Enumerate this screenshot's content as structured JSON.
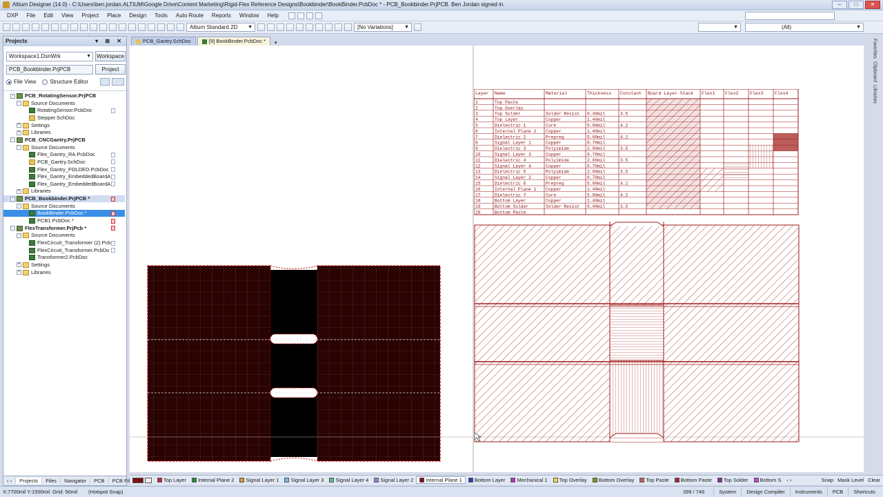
{
  "titlebar": {
    "title": "Altium Designer (14.0) - C:\\Users\\ben.jordan.ALTIUM\\Google Drive\\Content Marketing\\Rigid-Flex Reference Designs\\Bookbinder\\BookBinder.PcbDoc * - PCB_Bookbinder.PrjPCB. Ben Jordan signed in."
  },
  "menu": [
    "DXP",
    "File",
    "Edit",
    "View",
    "Project",
    "Place",
    "Design",
    "Tools",
    "Auto Route",
    "Reports",
    "Window",
    "Help"
  ],
  "toolbar": {
    "view_config": "Altium Standard 2D",
    "variations": "[No Variations]",
    "filter": "(All)"
  },
  "projects_panel": {
    "title": "Projects",
    "workspace_value": "Workspace1.DsnWrk",
    "workspace_button": "Workspace",
    "project_value": "PCB_Bookbinder.PrjPCB",
    "project_button": "Project",
    "radio_file_view": "File View",
    "radio_structure_editor": "Structure Editor",
    "tree": [
      {
        "label": "PCB_RotatingSensor.PrjPCB",
        "level": 0,
        "icon": "proj",
        "exp": "-",
        "bold": true
      },
      {
        "label": "Source Documents",
        "level": 1,
        "icon": "folder",
        "exp": "-"
      },
      {
        "label": "RotatingSensor.PcbDoc",
        "level": 2,
        "icon": "pcb",
        "mark": "plain"
      },
      {
        "label": "Stepper.SchDoc",
        "level": 2,
        "icon": "sch"
      },
      {
        "label": "Settings",
        "level": 1,
        "icon": "folder",
        "exp": "+"
      },
      {
        "label": "Libraries",
        "level": 1,
        "icon": "folder",
        "exp": "+"
      },
      {
        "label": "PCB_CNCGantry.PrjPCB",
        "level": 0,
        "icon": "proj",
        "exp": "-",
        "bold": true
      },
      {
        "label": "Source Documents",
        "level": 1,
        "icon": "folder",
        "exp": "-"
      },
      {
        "label": "Flex_Gantry_RA.PcbDoc",
        "level": 2,
        "icon": "pcb",
        "mark": "plain"
      },
      {
        "label": "PCB_Gantry.SchDoc",
        "level": 2,
        "icon": "sch",
        "mark": "plain"
      },
      {
        "label": "Flex_Gantry_FOLDED.PcbDoc",
        "level": 2,
        "icon": "pcb",
        "mark": "plain"
      },
      {
        "label": "Flex_Gantry_EmbeddedBoardA",
        "level": 2,
        "icon": "pcb",
        "mark": "plain"
      },
      {
        "label": "Flex_Gantry_EmbeddedBoardA",
        "level": 2,
        "icon": "pcb",
        "mark": "plain"
      },
      {
        "label": "Libraries",
        "level": 1,
        "icon": "folder",
        "exp": "+"
      },
      {
        "label": "PCB_Bookbinder.PrjPCB *",
        "level": 0,
        "icon": "proj",
        "exp": "-",
        "bold": true,
        "state": "hl",
        "mark": "red"
      },
      {
        "label": "Source Documents",
        "level": 1,
        "icon": "folder",
        "exp": "-"
      },
      {
        "label": "BookBinder.PcbDoc *",
        "level": 2,
        "icon": "pcb",
        "state": "sel",
        "mark": "red"
      },
      {
        "label": "PCB1.PcbDoc *",
        "level": 2,
        "icon": "pcb",
        "mark": "red"
      },
      {
        "label": "FlexTransformer.PrjPcb *",
        "level": 0,
        "icon": "proj",
        "exp": "-",
        "bold": true,
        "mark": "red"
      },
      {
        "label": "Source Documents",
        "level": 1,
        "icon": "folder",
        "exp": "-"
      },
      {
        "label": "FlexCircuit_Transformer (2).Pcb",
        "level": 2,
        "icon": "pcb",
        "mark": "plain"
      },
      {
        "label": "FlexCircuit_Transformer.PcbDo",
        "level": 2,
        "icon": "pcb",
        "mark": "plain"
      },
      {
        "label": "Transformer2.PcbDoc",
        "level": 2,
        "icon": "pcb"
      },
      {
        "label": "Settings",
        "level": 1,
        "icon": "folder",
        "exp": "+"
      },
      {
        "label": "Libraries",
        "level": 1,
        "icon": "folder",
        "exp": "+"
      }
    ],
    "bottom_tabs": [
      "Projects",
      "Files",
      "Navigator",
      "PCB",
      "PCB Filter"
    ]
  },
  "doc_tabs": [
    {
      "label": "PCB_Gantry.SchDoc",
      "active": false
    },
    {
      "label": "[9] BookBinder.PcbDoc *",
      "active": true
    }
  ],
  "stack_table": {
    "headers": [
      "Layer",
      "Name",
      "Material",
      "Thickness",
      "Constant",
      "Board Layer Stack",
      "Flex1",
      "Flex2",
      "Flex3",
      "Flex4"
    ],
    "rows": [
      [
        "1",
        "Top Paste",
        "",
        "",
        ""
      ],
      [
        "2",
        "Top Overlay",
        "",
        "",
        ""
      ],
      [
        "3",
        "Top Solder",
        "Solder Resist",
        "0.40mil",
        "3.5"
      ],
      [
        "4",
        "Top Layer",
        "Copper",
        "1.40mil",
        ""
      ],
      [
        "5",
        "Dielectric 1",
        "Core",
        "5.00mil",
        "4.2"
      ],
      [
        "6",
        "Internal Plane 2",
        "Copper",
        "1.40mil",
        ""
      ],
      [
        "7",
        "Dielectric 2",
        "Prepreg",
        "5.00mil",
        "4.2"
      ],
      [
        "8",
        "Signal Layer 1",
        "Copper",
        "0.70mil",
        ""
      ],
      [
        "9",
        "Dielectric 3",
        "Polyimide",
        "2.00mil",
        "3.5"
      ],
      [
        "10",
        "Signal Layer 3",
        "Copper",
        "0.70mil",
        ""
      ],
      [
        "11",
        "Dielectric 4",
        "Polyimide",
        "2.00mil",
        "3.5"
      ],
      [
        "12",
        "Signal Layer 4",
        "Copper",
        "0.70mil",
        ""
      ],
      [
        "13",
        "Dielectric 5",
        "Polyimide",
        "2.00mil",
        "3.5"
      ],
      [
        "14",
        "Signal Layer 2",
        "Copper",
        "0.70mil",
        ""
      ],
      [
        "15",
        "Dielectric 6",
        "Prepreg",
        "5.00mil",
        "4.2"
      ],
      [
        "16",
        "Internal Plane 1",
        "Copper",
        "1.40mil",
        ""
      ],
      [
        "17",
        "Dielectric 7",
        "Core",
        "5.00mil",
        "4.2"
      ],
      [
        "18",
        "Bottom Layer",
        "Copper",
        "1.40mil",
        ""
      ],
      [
        "19",
        "Bottom Solder",
        "Solder Resist",
        "0.40mil",
        "3.5"
      ],
      [
        "20",
        "Bottom Paste",
        "",
        "",
        ""
      ]
    ]
  },
  "layer_tabs": [
    {
      "label": "Top Layer",
      "color": "#c8242c"
    },
    {
      "label": "Internal Plane 2",
      "color": "#2a8a3a"
    },
    {
      "label": "Signal Layer 1",
      "color": "#c89a2b"
    },
    {
      "label": "Signal Layer 3",
      "color": "#7fb3e0"
    },
    {
      "label": "Signal Layer 4",
      "color": "#54c08a"
    },
    {
      "label": "Signal Layer 2",
      "color": "#a080d0"
    },
    {
      "label": "Internal Plane 1",
      "color": "#7a1010",
      "active": true
    },
    {
      "label": "Bottom Layer",
      "color": "#2040c0"
    },
    {
      "label": "Mechanical 1",
      "color": "#c030c0"
    },
    {
      "label": "Top Overlay",
      "color": "#f0e040"
    },
    {
      "label": "Bottom Overlay",
      "color": "#809020"
    },
    {
      "label": "Top Paste",
      "color": "#c06060"
    },
    {
      "label": "Bottom Paste",
      "color": "#a02828"
    },
    {
      "label": "Top Solder",
      "color": "#8030a0"
    },
    {
      "label": "Bottom S",
      "color": "#d040d0"
    }
  ],
  "layer_extra": [
    "Snap",
    "Mask Level",
    "Clear"
  ],
  "status": {
    "coords": "X:7700mil Y:1500mil",
    "grid": "Grid: 50mil",
    "snap": "(Hotspot Snap)",
    "count": "399 / 746",
    "right": [
      "System",
      "Design Compiler",
      "Instruments",
      "PCB",
      "Shortcuts"
    ]
  },
  "right_strip": [
    "Favorites",
    "Clipboard",
    "Libraries"
  ],
  "colors": {
    "board_fill": "#2a0303",
    "board_outline": "#c00000",
    "hatch": "#a01818"
  }
}
